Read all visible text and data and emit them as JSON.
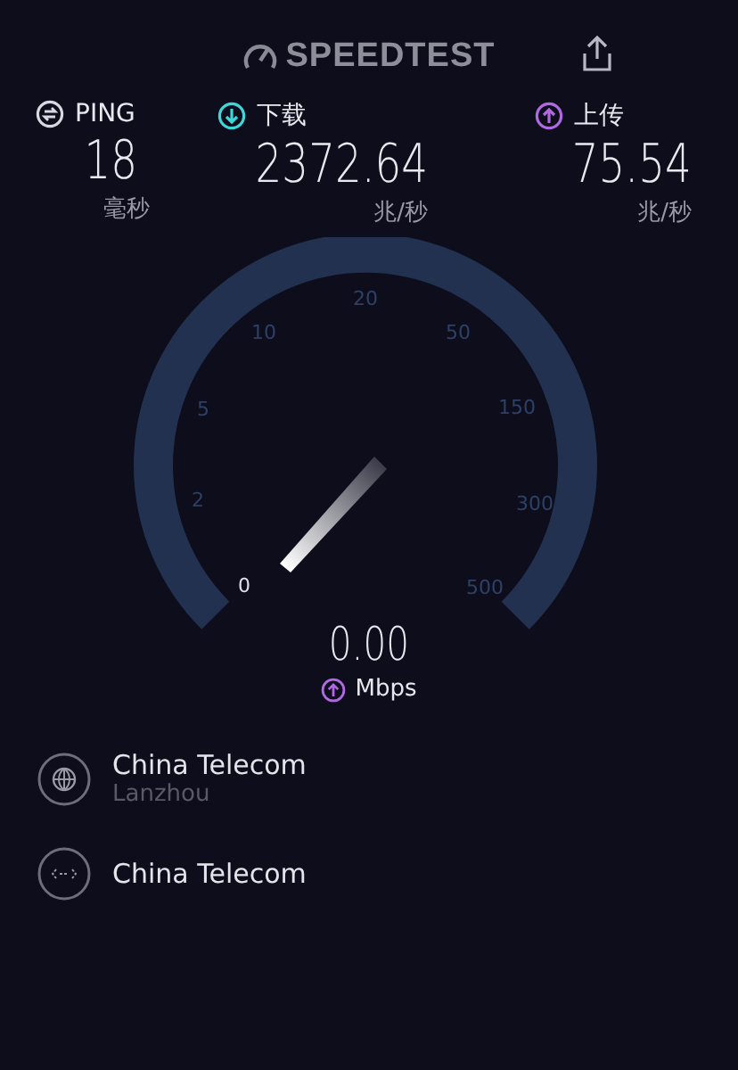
{
  "header": {
    "logo": "SPEEDTEST"
  },
  "stats": [
    {
      "kind": "ping",
      "label": "PING",
      "value": "18",
      "unit": "毫秒"
    },
    {
      "kind": "download",
      "label": "下载",
      "value": "2372.64",
      "unit": "兆/秒"
    },
    {
      "kind": "upload",
      "label": "上传",
      "value": "75.54",
      "unit": "兆/秒"
    }
  ],
  "gauge": {
    "ticks": [
      {
        "label": "0",
        "active": true
      },
      {
        "label": "2",
        "active": false
      },
      {
        "label": "5",
        "active": false
      },
      {
        "label": "10",
        "active": false
      },
      {
        "label": "20",
        "active": false
      },
      {
        "label": "50",
        "active": false
      },
      {
        "label": "150",
        "active": false
      },
      {
        "label": "300",
        "active": false
      },
      {
        "label": "500",
        "active": false
      }
    ],
    "reading": "0.00",
    "unit": "Mbps"
  },
  "servers": [
    {
      "kind": "isp",
      "name": "China Telecom",
      "location": "Lanzhou"
    },
    {
      "kind": "server",
      "name": "China Telecom"
    }
  ]
}
